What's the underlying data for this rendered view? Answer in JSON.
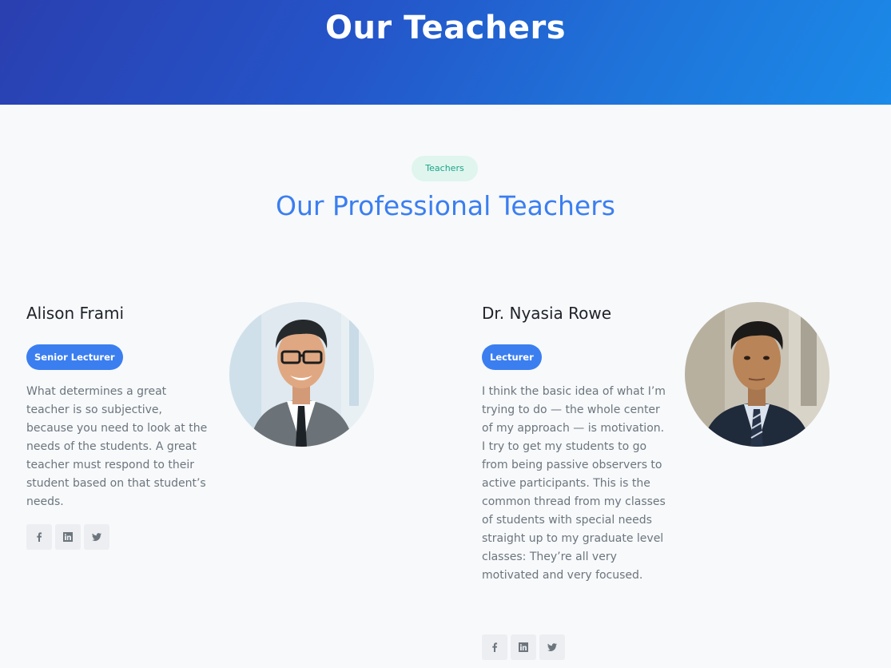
{
  "hero": {
    "title": "Our Teachers"
  },
  "section": {
    "badge": "Teachers",
    "title": "Our Professional Teachers"
  },
  "colors": {
    "accent": "#3b7ef0",
    "badge_bg": "#dff5ee",
    "badge_text": "#1ba588"
  },
  "teachers": [
    {
      "name": "Alison Frami",
      "role": "Senior Lecturer",
      "bio": "What determines a great teacher is so subjective, because you need to look at the needs of the students. A great teacher must respond to their student based on that student’s needs.",
      "socials": [
        "facebook-icon",
        "linkedin-icon",
        "twitter-icon"
      ]
    },
    {
      "name": "Dr. Nyasia Rowe",
      "role": "Lecturer",
      "bio": "I think the basic idea of what I’m trying to do — the whole center of my approach — is motivation. I try to get my students to go from being passive observers to active participants. This is the common thread from my classes of students with special needs straight up to my graduate level classes: They’re all very motivated and very focused.",
      "socials": [
        "facebook-icon",
        "linkedin-icon",
        "twitter-icon"
      ]
    }
  ]
}
